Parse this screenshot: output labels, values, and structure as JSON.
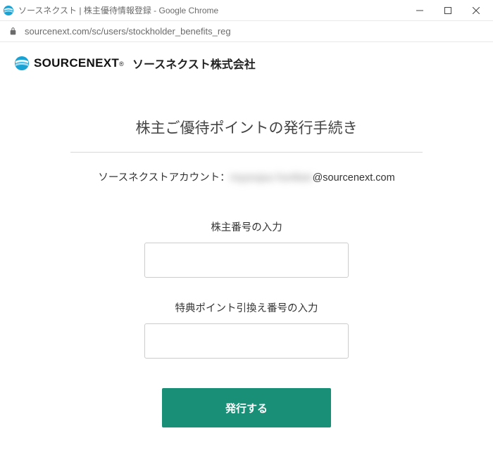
{
  "window": {
    "title": "ソースネクスト | 株主優待情報登録 - Google Chrome"
  },
  "addressbar": {
    "url": "sourcenext.com/sc/users/stockholder_benefits_reg"
  },
  "header": {
    "logo_text": "SOURCENEXT",
    "logo_reg": "®",
    "company_name": "ソースネクスト株式会社"
  },
  "main": {
    "title": "株主ご優待ポイントの発行手続き",
    "account_label": "ソースネクストアカウント：",
    "account_blurred": "myyoujuu hunikan",
    "account_domain": "@sourcenext.com",
    "field1_label": "株主番号の入力",
    "field1_value": "",
    "field2_label": "特典ポイント引換え番号の入力",
    "field2_value": "",
    "submit_label": "発行する"
  }
}
